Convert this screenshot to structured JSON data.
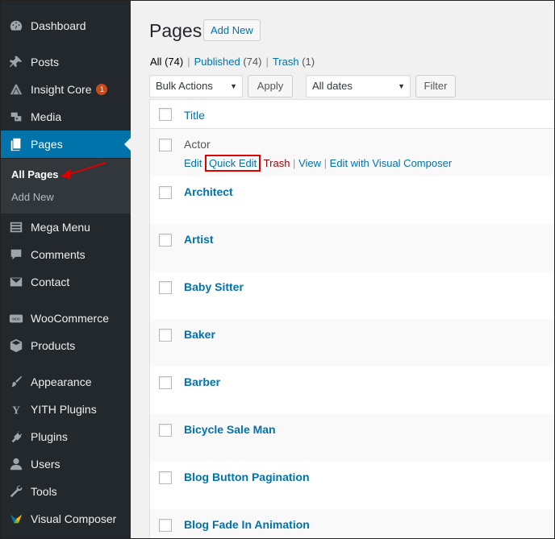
{
  "sidebar": {
    "items": [
      {
        "label": "Dashboard",
        "icon": "dashboard-icon"
      },
      {
        "label": "Posts",
        "icon": "pin-icon"
      },
      {
        "label": "Insight Core",
        "icon": "insight-icon",
        "badge": "1"
      },
      {
        "label": "Media",
        "icon": "media-icon"
      },
      {
        "label": "Pages",
        "icon": "pages-icon"
      },
      {
        "label": "Mega Menu",
        "icon": "list-icon"
      },
      {
        "label": "Comments",
        "icon": "comment-icon"
      },
      {
        "label": "Contact",
        "icon": "mail-icon"
      },
      {
        "label": "WooCommerce",
        "icon": "woo-icon",
        "icon_text": "woo"
      },
      {
        "label": "Products",
        "icon": "box-icon"
      },
      {
        "label": "Appearance",
        "icon": "brush-icon"
      },
      {
        "label": "YITH Plugins",
        "icon": "yith-icon",
        "icon_text": "Y"
      },
      {
        "label": "Plugins",
        "icon": "plug-icon"
      },
      {
        "label": "Users",
        "icon": "user-icon"
      },
      {
        "label": "Tools",
        "icon": "wrench-icon"
      },
      {
        "label": "Visual Composer",
        "icon": "vc-icon"
      }
    ],
    "submenu": {
      "all_pages": "All Pages",
      "add_new": "Add New"
    }
  },
  "header": {
    "title": "Pages",
    "add_new": "Add New"
  },
  "views": {
    "all": "All",
    "all_count": "(74)",
    "published": "Published",
    "published_count": "(74)",
    "trash": "Trash",
    "trash_count": "(1)",
    "sep": "|"
  },
  "filters": {
    "bulk_actions": "Bulk Actions",
    "apply": "Apply",
    "dates": "All dates",
    "filter": "Filter",
    "caret": "▼"
  },
  "table": {
    "column_title": "Title",
    "rows": [
      {
        "title": "Actor"
      },
      {
        "title": "Architect"
      },
      {
        "title": "Artist"
      },
      {
        "title": "Baby Sitter"
      },
      {
        "title": "Baker"
      },
      {
        "title": "Barber"
      },
      {
        "title": "Bicycle Sale Man"
      },
      {
        "title": "Blog Button Pagination"
      },
      {
        "title": "Blog Fade In Animation"
      }
    ],
    "row_actions": {
      "edit": "Edit",
      "quick_edit": "Quick Edit",
      "trash": "Trash",
      "view": "View",
      "edit_vc": "Edit with Visual Composer",
      "sep": "|"
    }
  },
  "colors": {
    "accent": "#0073aa",
    "sidebar": "#23282d",
    "highlight": "#dd0000",
    "trash": "#aa0000"
  }
}
